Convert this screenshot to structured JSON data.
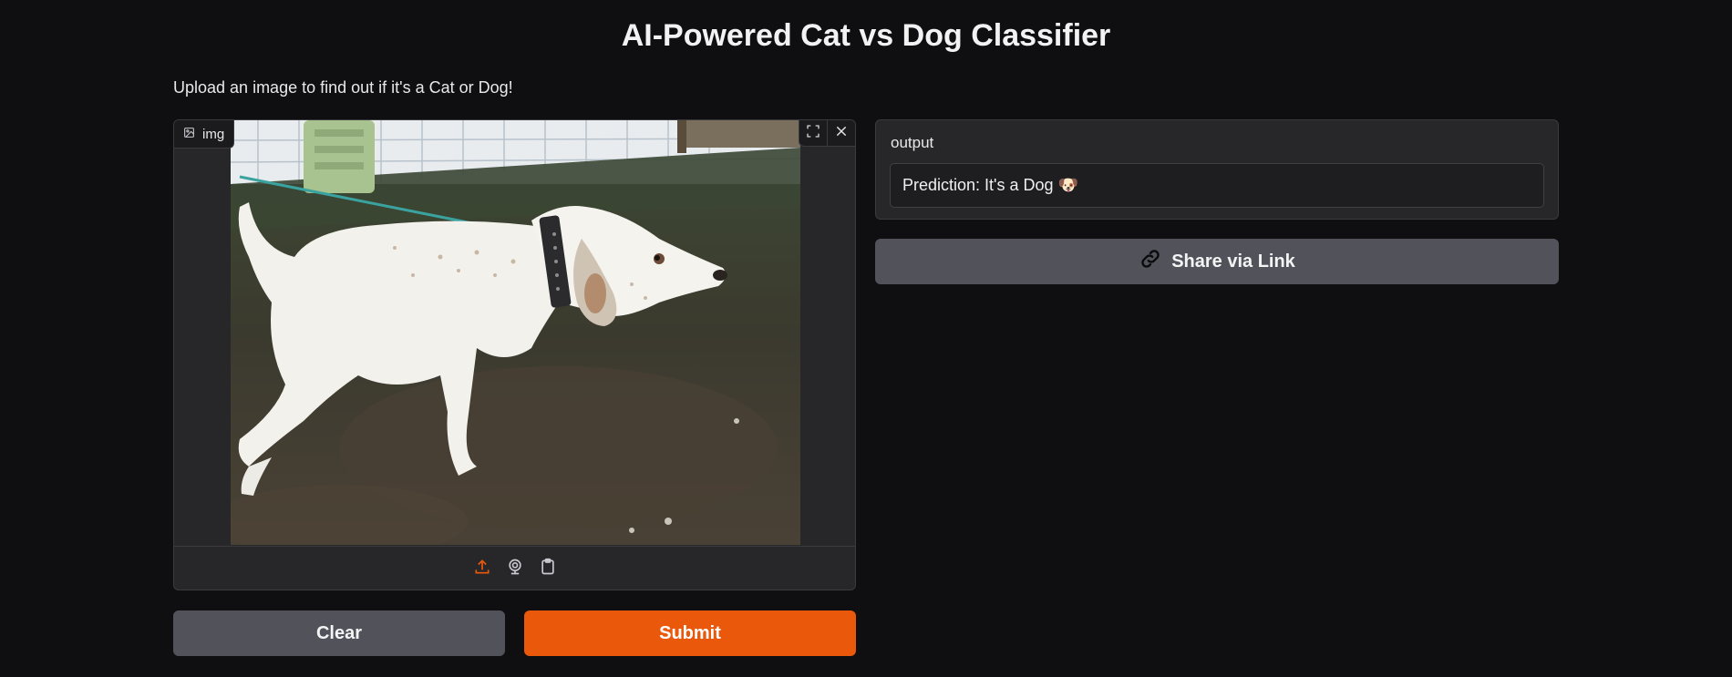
{
  "header": {
    "title": "AI-Powered Cat vs Dog Classifier",
    "description": "Upload an image to find out if it's a Cat or Dog!"
  },
  "image_input": {
    "label": "img",
    "icons": [
      "image-icon",
      "fullscreen-icon",
      "close-icon",
      "upload-icon",
      "webcam-icon",
      "clipboard-icon"
    ]
  },
  "output": {
    "label": "output",
    "value": "Prediction: It's a Dog 🐶"
  },
  "buttons": {
    "clear": "Clear",
    "submit": "Submit",
    "share": "Share via Link"
  },
  "colors": {
    "background": "#0f0f11",
    "panel": "#27272a",
    "accent": "#ea580c",
    "secondary_button": "#52525b"
  }
}
